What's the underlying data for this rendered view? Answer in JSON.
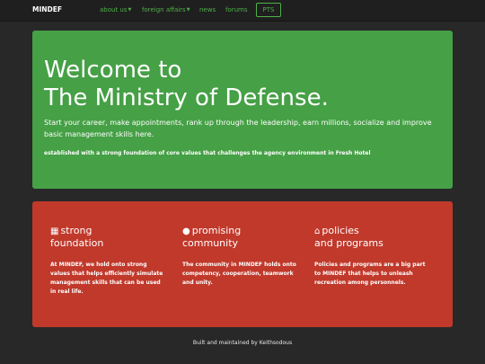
{
  "navbar": {
    "brand": "MINDEF",
    "items": [
      {
        "label": "about us",
        "dropdown": true
      },
      {
        "label": "foreign affairs",
        "dropdown": true
      },
      {
        "label": "news",
        "dropdown": false
      },
      {
        "label": "forums",
        "dropdown": false
      }
    ],
    "button_label": "PTS"
  },
  "hero": {
    "title_line1": "Welcome to",
    "title_line2": "The Ministry of Defense.",
    "lead": "Start your career, make appointments, rank up through the leadership, earn millions, socialize and improve basic management skills here.",
    "small": "established with a strong foundation of core values that challenges the agency environment in Fresh Hotel"
  },
  "features": [
    {
      "icon": "building-icon",
      "title_line1": "strong",
      "title_line2": "foundation",
      "text": "At MINDEF, we hold onto strong values that helps efficiently simulate management skills that can be used in real life."
    },
    {
      "icon": "globe-icon",
      "title_line1": "promising",
      "title_line2": "community",
      "text": "The community in MINDEF holds onto competency, cooperation, teamwork and unity."
    },
    {
      "icon": "bank-icon",
      "title_line1": "policies",
      "title_line2": "and programs",
      "text": "Policies and programs are a big part to MINDEF that helps to unleash recreation among personnels."
    }
  ],
  "footer": "Built and maintained by Keithsodous",
  "colors": {
    "accent_green": "#4fb048",
    "hero_bg": "#46a046",
    "panel_bg": "#c0392b",
    "page_bg": "#282828"
  }
}
